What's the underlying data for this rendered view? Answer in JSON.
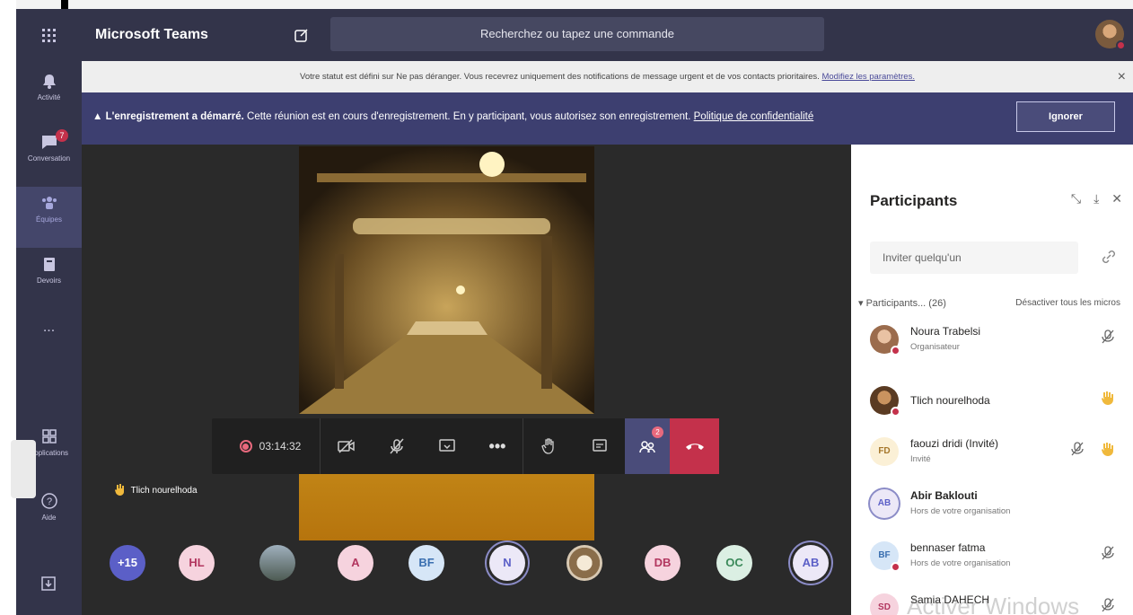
{
  "app": {
    "title": "Microsoft Teams",
    "search_placeholder": "Recherchez ou tapez une commande"
  },
  "rail": {
    "items": [
      {
        "label": "Activité",
        "icon": "bell-icon"
      },
      {
        "label": "Conversation",
        "icon": "chat-icon",
        "badge": "7"
      },
      {
        "label": "Équipes",
        "icon": "teams-icon"
      },
      {
        "label": "Devoirs",
        "icon": "assignments-icon"
      },
      {
        "label": "...",
        "icon": "more-icon"
      },
      {
        "label": "Applications",
        "icon": "apps-icon"
      },
      {
        "label": "Aide",
        "icon": "help-icon"
      }
    ]
  },
  "dnd_banner": {
    "text": "Votre statut est défini sur Ne pas déranger. Vous recevrez uniquement des notifications de message urgent et de vos contacts prioritaires.",
    "link": "Modifiez les paramètres."
  },
  "recording_banner": {
    "bold": "L'enregistrement a démarré.",
    "text": "Cette réunion est en cours d'enregistrement. En y participant, vous autorisez son enregistrement.",
    "link": "Politique de confidentialité",
    "button": "Ignorer"
  },
  "call": {
    "timer": "03:14:32",
    "participants_badge": "2",
    "speaking_name": "Tlich nourelhoda"
  },
  "bottom_avatars": [
    {
      "initials": "+15",
      "bg": "#5b5fc7",
      "fg": "#ffffff"
    },
    {
      "initials": "HL",
      "bg": "#f6d3de",
      "fg": "#b2365f"
    },
    {
      "initials": "",
      "bg": "#6f7c86",
      "fg": "#ffffff",
      "photo": true
    },
    {
      "initials": "A",
      "bg": "#f6d3de",
      "fg": "#b2365f"
    },
    {
      "initials": "BF",
      "bg": "#d6e6f7",
      "fg": "#3a6fb0"
    },
    {
      "initials": "N",
      "bg": "#ece8f7",
      "fg": "#5b5fc7",
      "ring": true
    },
    {
      "initials": "",
      "bg": "#d7c8b2",
      "fg": "#ffffff",
      "photo": true
    },
    {
      "initials": "DB",
      "bg": "#f6d3de",
      "fg": "#b2365f"
    },
    {
      "initials": "OC",
      "bg": "#dbefe3",
      "fg": "#3b8a5a"
    },
    {
      "initials": "AB",
      "bg": "#ece8f7",
      "fg": "#5b5fc7",
      "ring": true
    }
  ],
  "panel": {
    "title": "Participants",
    "invite_placeholder": "Inviter quelqu'un",
    "section_label": "Participants... (26)",
    "mute_all": "Désactiver tous les micros",
    "participants": [
      {
        "name": "Noura Trabelsi",
        "sub": "Organisateur",
        "initials": "",
        "avatar_bg": "#b98a6d",
        "photo": true,
        "muted": true,
        "hand": false,
        "status": true
      },
      {
        "name": "Tlich nourelhoda",
        "sub": "",
        "initials": "",
        "avatar_bg": "#7a5536",
        "photo": true,
        "muted": false,
        "hand": true,
        "status": true
      },
      {
        "name": "faouzi dridi (Invité)",
        "sub": "Invité",
        "initials": "FD",
        "avatar_bg": "#fbf0d6",
        "fg": "#a5762a",
        "muted": true,
        "hand": true,
        "status": false
      },
      {
        "name": "Abir Baklouti",
        "sub": "Hors de votre organisation",
        "initials": "AB",
        "avatar_bg": "#ece8f7",
        "fg": "#5b5fc7",
        "muted": false,
        "hand": false,
        "status": false,
        "bold": true
      },
      {
        "name": "bennaser fatma",
        "sub": "Hors de votre organisation",
        "initials": "BF",
        "avatar_bg": "#d6e6f7",
        "fg": "#3a6fb0",
        "muted": true,
        "hand": false,
        "status": true
      },
      {
        "name": "Samia DAHECH",
        "sub": "",
        "initials": "SD",
        "avatar_bg": "#f6d3de",
        "fg": "#b2365f",
        "muted": true,
        "hand": false,
        "status": false
      }
    ]
  },
  "watermark": "Activer Windows"
}
